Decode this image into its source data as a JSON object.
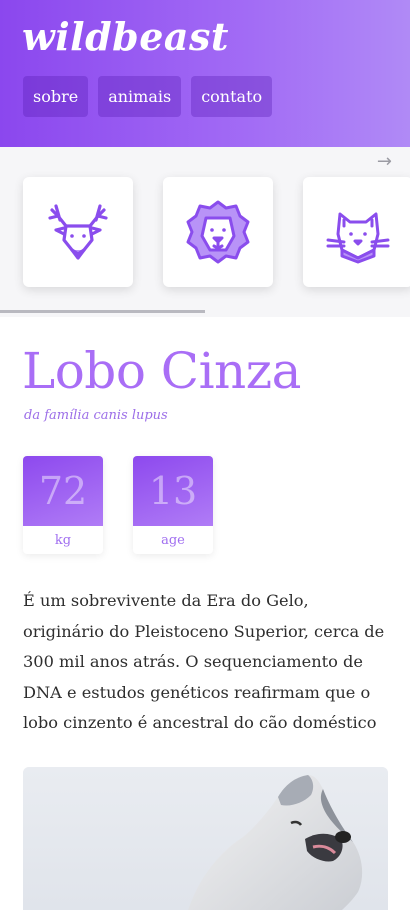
{
  "header": {
    "logo": "wildbeast",
    "nav": [
      "sobre",
      "animais",
      "contato"
    ]
  },
  "carousel": {
    "next_arrow": "→",
    "items": [
      {
        "icon": "deer-icon"
      },
      {
        "icon": "lion-icon"
      },
      {
        "icon": "cat-icon"
      }
    ],
    "scroll_progress": 0.5
  },
  "animal": {
    "name": "Lobo Cinza",
    "family": "da família canis lupus",
    "stats": [
      {
        "value": "72",
        "label": "kg"
      },
      {
        "value": "13",
        "label": "age"
      }
    ],
    "description": "É um sobrevivente da Era do Gelo, originário do Pleistoceno Superior, cerca de 300 mil anos atrás. O sequenciamento de DNA e estudos genéticos reafirmam que o lobo cinzento é ancestral do cão doméstico",
    "photo": "howling-wolf-photo"
  },
  "colors": {
    "accent": "#a96ef6",
    "header_start": "#8b47ee",
    "header_end": "#b08af6",
    "icon_stroke": "#8a4ded"
  }
}
